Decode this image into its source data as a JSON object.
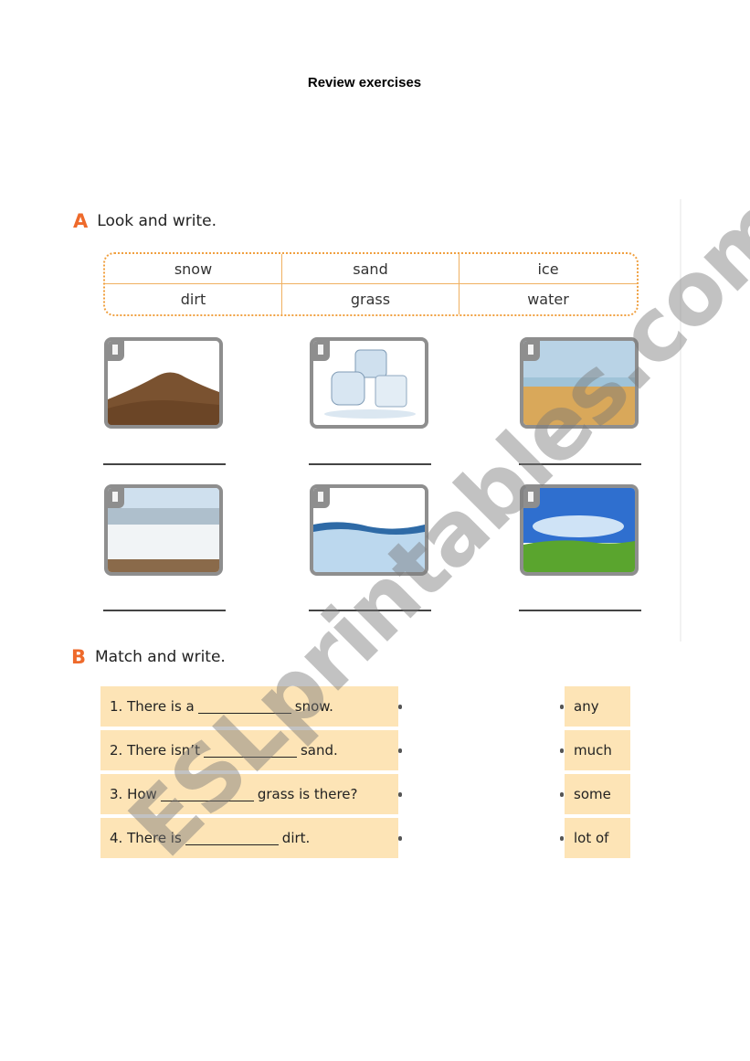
{
  "page": {
    "title": "Review exercises"
  },
  "section_a": {
    "letter": "A",
    "title": "Look and write.",
    "word_bank": [
      [
        "snow",
        "sand",
        "ice"
      ],
      [
        "dirt",
        "grass",
        "water"
      ]
    ],
    "pictures": [
      {
        "depicts": "dirt pile",
        "answer": ""
      },
      {
        "depicts": "ice cubes",
        "answer": ""
      },
      {
        "depicts": "sand beach",
        "answer": ""
      },
      {
        "depicts": "snow landscape",
        "answer": ""
      },
      {
        "depicts": "water splash",
        "answer": ""
      },
      {
        "depicts": "grass field",
        "answer": ""
      }
    ]
  },
  "section_b": {
    "letter": "B",
    "title": "Match and write.",
    "sentences": [
      {
        "before": "1.  There is a",
        "after": "snow."
      },
      {
        "before": "2. There isn’t",
        "after": "sand."
      },
      {
        "before": "3. How",
        "after": "grass is there?"
      },
      {
        "before": "4. There is",
        "after": "dirt."
      }
    ],
    "options": [
      "any",
      "much",
      "some",
      "lot of"
    ]
  },
  "watermark": "ESLprintables.com",
  "colors": {
    "accent": "#ee6a2b",
    "row_fill": "#fde4b6",
    "dotted_border": "#f0a040",
    "frame": "#8e8e8e"
  }
}
